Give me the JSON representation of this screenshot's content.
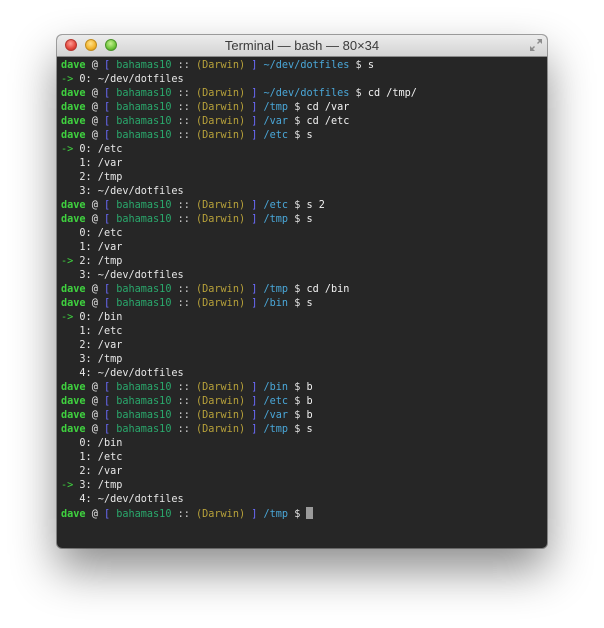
{
  "window": {
    "title": "Terminal — bash — 80×34"
  },
  "prompt": {
    "user": "dave",
    "at": "@",
    "bracket_open": "[",
    "host": "bahamas10",
    "sep": "::",
    "os": "(Darwin)",
    "bracket_close": "]",
    "dollar": "$"
  },
  "lines": [
    {
      "type": "prompt",
      "path": "~/dev/dotfiles",
      "cmd": "s"
    },
    {
      "type": "out",
      "marker": "->",
      "text": "0: ~/dev/dotfiles"
    },
    {
      "type": "prompt",
      "path": "~/dev/dotfiles",
      "cmd": "cd /tmp/"
    },
    {
      "type": "prompt",
      "path": "/tmp",
      "cmd": "cd /var"
    },
    {
      "type": "prompt",
      "path": "/var",
      "cmd": "cd /etc"
    },
    {
      "type": "prompt",
      "path": "/etc",
      "cmd": "s"
    },
    {
      "type": "out",
      "marker": "->",
      "text": "0: /etc"
    },
    {
      "type": "out",
      "marker": "",
      "text": "1: /var"
    },
    {
      "type": "out",
      "marker": "",
      "text": "2: /tmp"
    },
    {
      "type": "out",
      "marker": "",
      "text": "3: ~/dev/dotfiles"
    },
    {
      "type": "prompt",
      "path": "/etc",
      "cmd": "s 2"
    },
    {
      "type": "prompt",
      "path": "/tmp",
      "cmd": "s"
    },
    {
      "type": "out",
      "marker": "",
      "text": "0: /etc"
    },
    {
      "type": "out",
      "marker": "",
      "text": "1: /var"
    },
    {
      "type": "out",
      "marker": "->",
      "text": "2: /tmp"
    },
    {
      "type": "out",
      "marker": "",
      "text": "3: ~/dev/dotfiles"
    },
    {
      "type": "prompt",
      "path": "/tmp",
      "cmd": "cd /bin"
    },
    {
      "type": "prompt",
      "path": "/bin",
      "cmd": "s"
    },
    {
      "type": "out",
      "marker": "->",
      "text": "0: /bin"
    },
    {
      "type": "out",
      "marker": "",
      "text": "1: /etc"
    },
    {
      "type": "out",
      "marker": "",
      "text": "2: /var"
    },
    {
      "type": "out",
      "marker": "",
      "text": "3: /tmp"
    },
    {
      "type": "out",
      "marker": "",
      "text": "4: ~/dev/dotfiles"
    },
    {
      "type": "prompt",
      "path": "/bin",
      "cmd": "b"
    },
    {
      "type": "prompt",
      "path": "/etc",
      "cmd": "b"
    },
    {
      "type": "prompt",
      "path": "/var",
      "cmd": "b"
    },
    {
      "type": "prompt",
      "path": "/tmp",
      "cmd": "s"
    },
    {
      "type": "out",
      "marker": "",
      "text": "0: /bin"
    },
    {
      "type": "out",
      "marker": "",
      "text": "1: /etc"
    },
    {
      "type": "out",
      "marker": "",
      "text": "2: /var"
    },
    {
      "type": "out",
      "marker": "->",
      "text": "3: /tmp"
    },
    {
      "type": "out",
      "marker": "",
      "text": "4: ~/dev/dotfiles"
    },
    {
      "type": "prompt",
      "path": "/tmp",
      "cmd": "",
      "cursor": true
    }
  ],
  "colors": {
    "background": "#262626",
    "user": "#3fd23f",
    "bracket": "#6c6cff",
    "host": "#2aa86c",
    "paren": "#b35ec9",
    "os": "#b7a13a",
    "path": "#4aa7d8",
    "text": "#ececec"
  }
}
